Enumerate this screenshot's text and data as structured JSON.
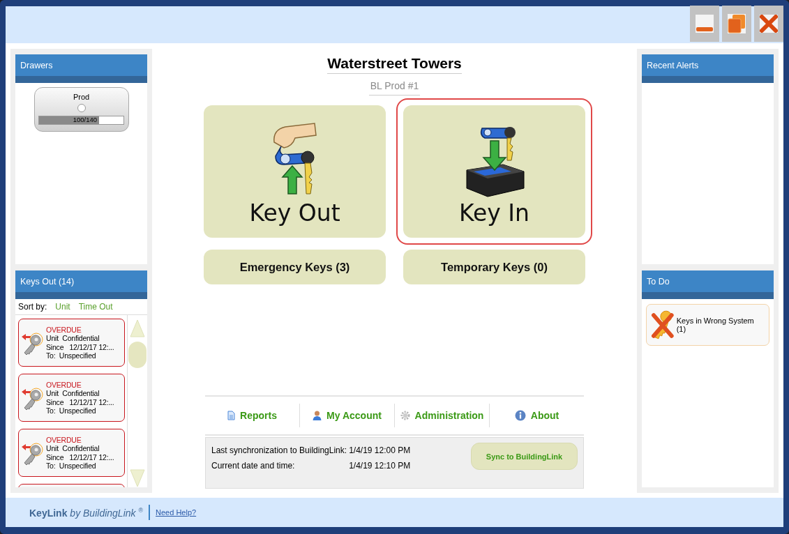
{
  "drawers": {
    "title": "Drawers",
    "items": [
      {
        "name": "Prod",
        "count": "100/140",
        "level": 0.714
      }
    ]
  },
  "keys_out": {
    "title": "Keys Out (14)",
    "sort_label": "Sort by:",
    "sort_options": [
      "Unit",
      "Time Out"
    ],
    "items": [
      {
        "status": "OVERDUE",
        "unit_label": "Unit",
        "unit": "Confidential",
        "since_label": "Since",
        "since": "12/12/17 12:...",
        "to_label": "To:",
        "to": "Unspecified"
      },
      {
        "status": "OVERDUE",
        "unit_label": "Unit",
        "unit": "Confidential",
        "since_label": "Since",
        "since": "12/12/17 12:...",
        "to_label": "To:",
        "to": "Unspecified"
      },
      {
        "status": "OVERDUE",
        "unit_label": "Unit",
        "unit": "Confidential",
        "since_label": "Since",
        "since": "12/12/17 12:...",
        "to_label": "To:",
        "to": "Unspecified"
      }
    ]
  },
  "header": {
    "title": "Waterstreet Towers",
    "subtitle": "BL Prod #1"
  },
  "actions": [
    {
      "kind": "out",
      "label": "Key Out",
      "selected": false
    },
    {
      "kind": "in",
      "label": "Key In",
      "selected": true
    }
  ],
  "secondary_actions": [
    {
      "label": "Emergency Keys (3)"
    },
    {
      "label": "Temporary Keys (0)"
    }
  ],
  "nav": [
    {
      "kind": "reports",
      "label": "Reports"
    },
    {
      "kind": "account",
      "label": "My Account"
    },
    {
      "kind": "admin",
      "label": "Administration"
    },
    {
      "kind": "about",
      "label": "About"
    }
  ],
  "sync": {
    "last_label": "Last synchronization to BuildingLink:",
    "last_value": "1/4/19 12:00 PM",
    "current_label": "Current date and time:",
    "current_value": "1/4/19 12:10 PM",
    "button": "Sync to BuildingLink"
  },
  "recent_alerts": {
    "title": "Recent Alerts"
  },
  "todo": {
    "title": "To Do",
    "items": [
      {
        "label": "Keys in Wrong System (1)"
      }
    ]
  },
  "footer": {
    "brand": "KeyLink",
    "brand_suffix": "by BuildingLink",
    "mark": "®",
    "help_link": "Need Help?"
  }
}
